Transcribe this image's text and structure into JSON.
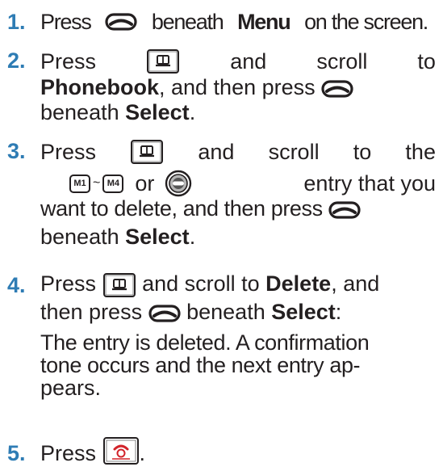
{
  "steps": [
    {
      "number": "1.",
      "text_a": "Press",
      "text_b": "beneath",
      "bold_a": "Menu",
      "text_c": "on the screen."
    },
    {
      "number": "2.",
      "text_a": "Press",
      "text_b": "and",
      "text_c": "scroll",
      "text_d": "to",
      "bold_a": "Phonebook",
      "text_e": ", and then press",
      "text_f": "beneath",
      "bold_b": "Select",
      "text_g": "."
    },
    {
      "number": "3.",
      "text_a": "Press",
      "text_b": "and",
      "text_c": "scroll",
      "text_d": "to",
      "text_e": "the",
      "key_m1": "M1",
      "tilde": "~",
      "key_m4": "M4",
      "text_f": "or",
      "text_g": "entry that you",
      "text_h": "want to delete, and then press",
      "text_i": "beneath",
      "bold_a": "Select",
      "text_j": "."
    },
    {
      "number": "4.",
      "text_a": "Press",
      "text_b": "and scroll to",
      "bold_a": "Delete",
      "text_c": ", and",
      "text_d": "then press",
      "text_e": "beneath",
      "bold_b": "Select",
      "text_f": ":",
      "result_1": "The entry is deleted. A confirmation",
      "result_2": "tone occurs and the next entry ap-",
      "result_3": "pears."
    },
    {
      "number": "5.",
      "text_a": "Press",
      "text_b": "."
    }
  ]
}
